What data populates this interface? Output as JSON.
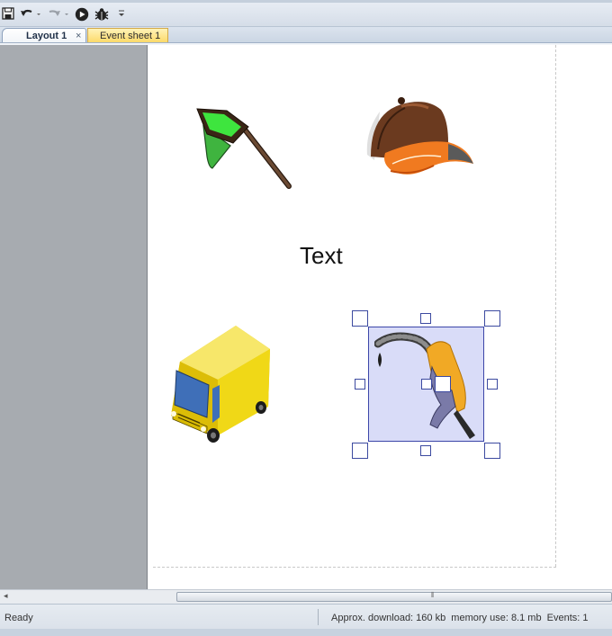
{
  "toolbar": {
    "buttons": [
      {
        "name": "save-icon"
      },
      {
        "name": "undo-icon"
      },
      {
        "name": "redo-icon"
      },
      {
        "name": "run-icon"
      },
      {
        "name": "debug-icon"
      },
      {
        "name": "customize-toolbar-icon"
      }
    ]
  },
  "tabs": [
    {
      "label": "Layout 1",
      "active": true,
      "close_glyph": "×"
    },
    {
      "label": "Event sheet 1",
      "active": false
    }
  ],
  "layout": {
    "objects": [
      {
        "name": "butterfly-net-sprite",
        "type": "sprite"
      },
      {
        "name": "baseball-cap-sprite",
        "type": "sprite"
      },
      {
        "name": "delivery-van-sprite",
        "type": "sprite"
      },
      {
        "name": "fuel-nozzle-sprite",
        "type": "sprite",
        "selected": true
      }
    ],
    "text_object": "Text"
  },
  "scrollbar": {
    "grip": "⦀"
  },
  "status": {
    "left": "Ready",
    "right": "Approx. download: 160 kb  memory use: 8.1 mb  Events: 1"
  },
  "colors": {
    "tab_event_bg": "#fcd865",
    "selection_fill": "#c6c9f3",
    "selection_border": "#3c46a8",
    "gutter": "#a7abb0"
  }
}
